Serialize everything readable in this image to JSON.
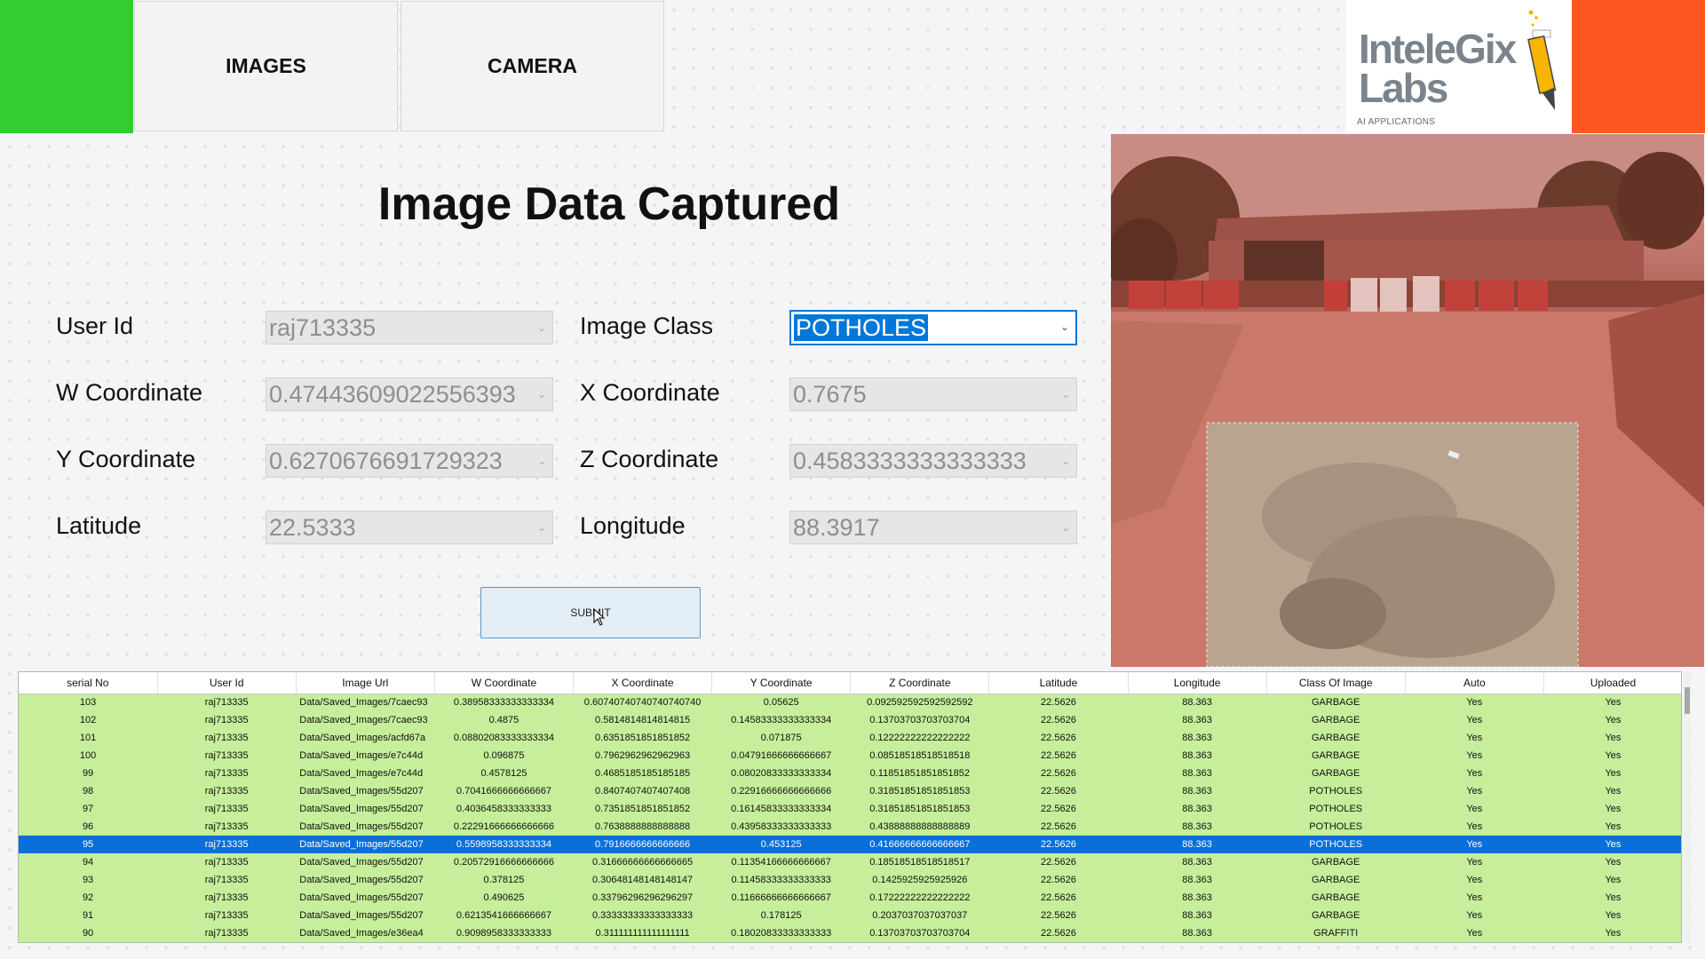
{
  "nav": {
    "images_label": "IMAGES",
    "camera_label": "CAMERA"
  },
  "logo": {
    "line1": "InteleGix",
    "line2": "Labs",
    "tagline": "AI APPLICATIONS"
  },
  "page": {
    "title": "Image Data Captured"
  },
  "form": {
    "user_id": {
      "label": "User Id",
      "value": "raj713335"
    },
    "image_class": {
      "label": "Image Class",
      "value": "POTHOLES"
    },
    "w_coordinate": {
      "label": "W Coordinate",
      "value": "0.47443609022556393"
    },
    "x_coordinate": {
      "label": "X Coordinate",
      "value": "0.7675"
    },
    "y_coordinate": {
      "label": "Y Coordinate",
      "value": "0.6270676691729323"
    },
    "z_coordinate": {
      "label": "Z Coordinate",
      "value": "0.4583333333333333"
    },
    "latitude": {
      "label": "Latitude",
      "value": "22.5333"
    },
    "longitude": {
      "label": "Longitude",
      "value": "88.3917"
    },
    "submit_label": "SUBMIT"
  },
  "table": {
    "columns": [
      "serial No",
      "User Id",
      "Image Url",
      "W Coordinate",
      "X Coordinate",
      "Y Coordinate",
      "Z Coordinate",
      "Latitude",
      "Longitude",
      "Class Of Image",
      "Auto",
      "Uploaded"
    ],
    "selected_index": 8,
    "rows": [
      [
        "103",
        "raj713335",
        "Data/Saved_Images/7caec93",
        "0.38958333333333334",
        "0.60740740740740740740",
        "0.05625",
        "0.092592592592592592",
        "22.5626",
        "88.363",
        "GARBAGE",
        "Yes",
        "Yes"
      ],
      [
        "102",
        "raj713335",
        "Data/Saved_Images/7caec93",
        "0.4875",
        "0.5814814814814815",
        "0.14583333333333334",
        "0.13703703703703704",
        "22.5626",
        "88.363",
        "GARBAGE",
        "Yes",
        "Yes"
      ],
      [
        "101",
        "raj713335",
        "Data/Saved_Images/acfd67a",
        "0.08802083333333334",
        "0.6351851851851852",
        "0.071875",
        "0.12222222222222222",
        "22.5626",
        "88.363",
        "GARBAGE",
        "Yes",
        "Yes"
      ],
      [
        "100",
        "raj713335",
        "Data/Saved_Images/e7c44d",
        "0.096875",
        "0.7962962962962963",
        "0.04791666666666667",
        "0.08518518518518518",
        "22.5626",
        "88.363",
        "GARBAGE",
        "Yes",
        "Yes"
      ],
      [
        "99",
        "raj713335",
        "Data/Saved_Images/e7c44d",
        "0.4578125",
        "0.4685185185185185",
        "0.08020833333333334",
        "0.11851851851851852",
        "22.5626",
        "88.363",
        "GARBAGE",
        "Yes",
        "Yes"
      ],
      [
        "98",
        "raj713335",
        "Data/Saved_Images/55d207",
        "0.7041666666666667",
        "0.8407407407407408",
        "0.22916666666666666",
        "0.31851851851851853",
        "22.5626",
        "88.363",
        "POTHOLES",
        "Yes",
        "Yes"
      ],
      [
        "97",
        "raj713335",
        "Data/Saved_Images/55d207",
        "0.4036458333333333",
        "0.7351851851851852",
        "0.16145833333333334",
        "0.31851851851851853",
        "22.5626",
        "88.363",
        "POTHOLES",
        "Yes",
        "Yes"
      ],
      [
        "96",
        "raj713335",
        "Data/Saved_Images/55d207",
        "0.22291666666666666",
        "0.7638888888888888",
        "0.43958333333333333",
        "0.43888888888888889",
        "22.5626",
        "88.363",
        "POTHOLES",
        "Yes",
        "Yes"
      ],
      [
        "95",
        "raj713335",
        "Data/Saved_Images/55d207",
        "0.5598958333333334",
        "0.7916666666666666",
        "0.453125",
        "0.41666666666666667",
        "22.5626",
        "88.363",
        "POTHOLES",
        "Yes",
        "Yes"
      ],
      [
        "94",
        "raj713335",
        "Data/Saved_Images/55d207",
        "0.20572916666666666",
        "0.31666666666666665",
        "0.11354166666666667",
        "0.18518518518518517",
        "22.5626",
        "88.363",
        "GARBAGE",
        "Yes",
        "Yes"
      ],
      [
        "93",
        "raj713335",
        "Data/Saved_Images/55d207",
        "0.378125",
        "0.30648148148148147",
        "0.11458333333333333",
        "0.1425925925925926",
        "22.5626",
        "88.363",
        "GARBAGE",
        "Yes",
        "Yes"
      ],
      [
        "92",
        "raj713335",
        "Data/Saved_Images/55d207",
        "0.490625",
        "0.33796296296296297",
        "0.11666666666666667",
        "0.17222222222222222",
        "22.5626",
        "88.363",
        "GARBAGE",
        "Yes",
        "Yes"
      ],
      [
        "91",
        "raj713335",
        "Data/Saved_Images/55d207",
        "0.6213541666666667",
        "0.33333333333333333",
        "0.178125",
        "0.2037037037037037",
        "22.5626",
        "88.363",
        "GARBAGE",
        "Yes",
        "Yes"
      ],
      [
        "90",
        "raj713335",
        "Data/Saved_Images/e36ea4",
        "0.9098958333333333",
        "0.311111111111111111",
        "0.18020833333333333",
        "0.13703703703703704",
        "22.5626",
        "88.363",
        "GRAFFITI",
        "Yes",
        "Yes"
      ]
    ]
  }
}
